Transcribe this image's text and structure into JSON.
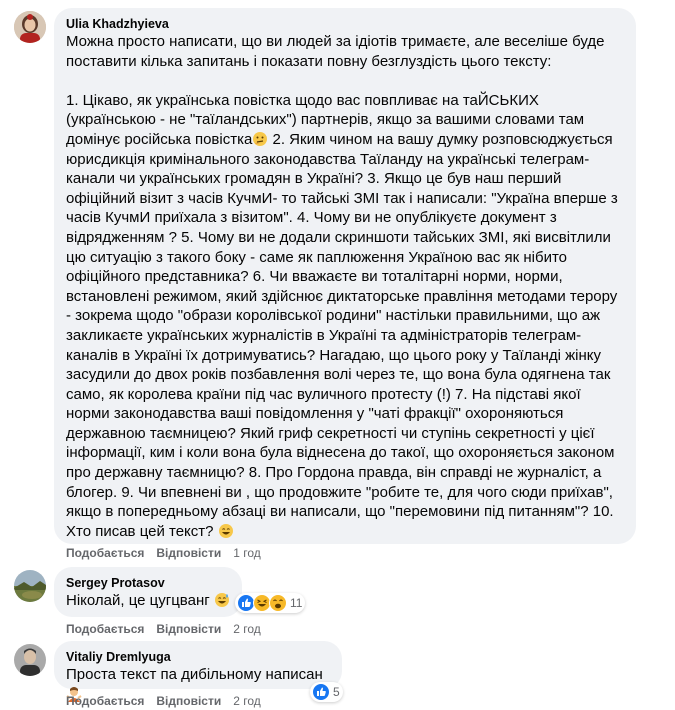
{
  "comments": [
    {
      "author": "Ulia Khadzhyieva",
      "text_parts": [
        "Можна просто написати, що ви людей за ідіотів тримаєте, але веселіше буде поставити кілька запитань і показати повну безглуздість цього тексту:\n\n1. Цікаво, як українська повістка щодо вас повпливає на таЙСЬКИХ (українською - не \"таїландських\") партнерів, якщо за вашими словами там домінує російська повістка",
        " 2. Яким чином на вашу думку розповсюджується юрисдикція кримінального законодавства Таїланду на українські телеграм-канали чи українських громадян в Україні? 3. Якщо це був наш перший офіційний візит з часів КучмИ- то тайські ЗМІ так і написали: \"Україна вперше з часів КучмИ приїхала з візитом\". 4. Чому ви не опублікуєте документ з відрядженням ? 5. Чому ви не додали скриншоти тайських ЗМІ, які висвітлили цю ситуацію з такого боку - саме як паплюження Україною вас як нібито офіційного представника? 6. Чи вважаєте ви тоталітарні норми, норми, встановлені режимом, який здійснює диктаторське правління методами терору - зокрема щодо \"образи королівської родини\" настільки правильними, що аж закликаєте українських журналістів в Україні та адміністраторів телеграм-каналів в Україні їх дотримуватись? Нагадаю, що цього року у Таїланді жінку засудили до двох років позбавлення волі через те, що вона була одягнена так само, як королева країни під час вуличного протесту (!) 7. На підставі якої норми законодавства ваші повідомлення у \"чаті фракції\" охороняються державною таємницею? Який гриф секретності чи ступінь секретності у цієї інформації, ким і коли вона була віднесена до такої, що охороняється законом про державну таємницю? 8. Про Гордона правда, він справді не журналіст, а блогер. 9. Чи впевнені ви , що продовжите \"робите те, для чого сюди приїхав\", якщо в попередньому абзаці ви написали, що \"перемовини під питанням\"? 10. Хто писав цей текст? "
      ],
      "like": "Подобається",
      "reply": "Відповісти",
      "time": "1 год"
    },
    {
      "author": "Sergey Protasov",
      "text": "Ніколай, це цугцванг ",
      "like": "Подобається",
      "reply": "Відповісти",
      "time": "2 год",
      "reaction_count": "11"
    },
    {
      "author": "Vitaliy Dremlyuga",
      "text": "Проста текст па дибільному написан ",
      "like": "Подобається",
      "reply": "Відповісти",
      "time": "2 год",
      "reaction_count": "5"
    }
  ],
  "colors": {
    "bubble": "#f0f2f5",
    "meta": "#65676b",
    "like_blue": "#1877f2",
    "haha_yellow": "#f7b928"
  }
}
